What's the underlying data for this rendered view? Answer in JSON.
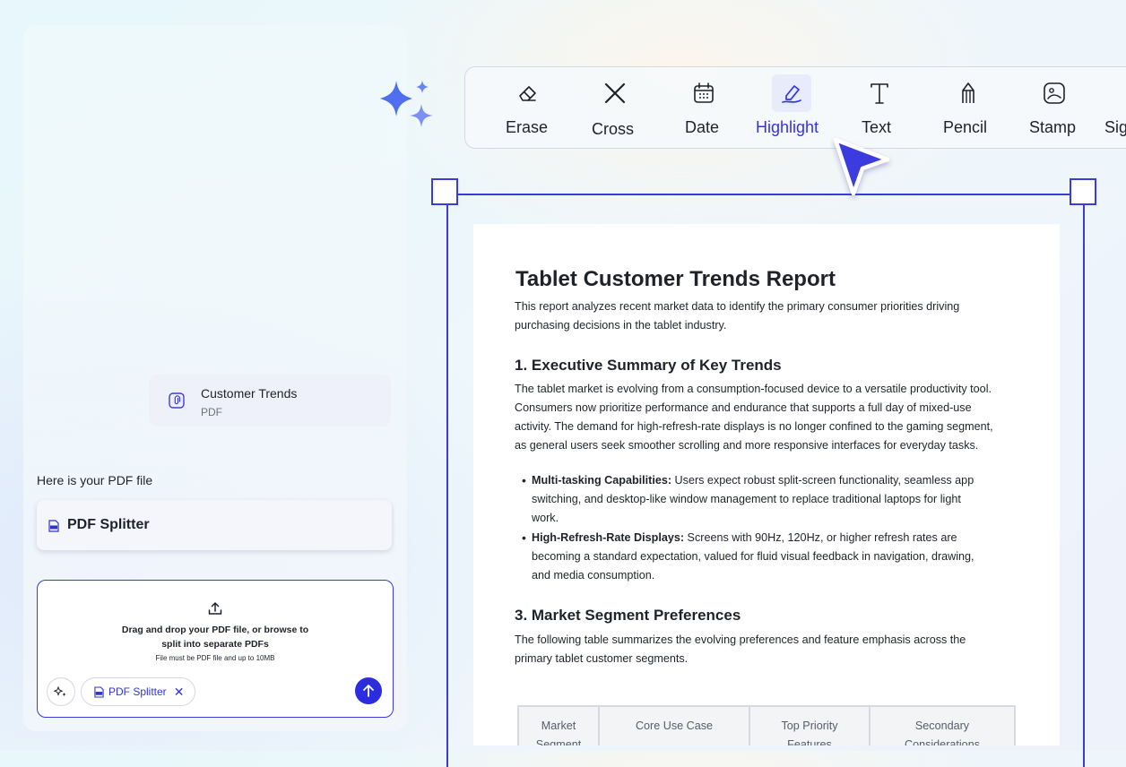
{
  "chat": {
    "file": {
      "name": "Customer Trends",
      "type": "PDF"
    },
    "intro": "Here is your PDF file",
    "tool_card_label": "PDF Splitter",
    "upload": {
      "line1": "Drag and drop your PDF file, or browse to",
      "line2": "split into separate PDFs",
      "hint": "File must be PDF file and up to 10MB",
      "chip_label": "PDF Splitter",
      "chip_close": "✕"
    }
  },
  "toolbar": {
    "active": "Highlight",
    "tools": [
      {
        "label": "Erase",
        "icon": "eraser-icon"
      },
      {
        "label": "Cross",
        "icon": "cross-icon"
      },
      {
        "label": "Date",
        "icon": "calendar-icon"
      },
      {
        "label": "Highlight",
        "icon": "highlighter-icon"
      },
      {
        "label": "Text",
        "icon": "text-icon"
      },
      {
        "label": "Pencil",
        "icon": "pencil-icon"
      },
      {
        "label": "Stamp",
        "icon": "stamp-icon"
      },
      {
        "label": "Sig",
        "icon": "signature-icon"
      }
    ]
  },
  "document": {
    "title": "Tablet Customer Trends Report",
    "intro": [
      "This report analyzes recent market data to identify the primary consumer priorities driving",
      "purchasing decisions in the tablet industry."
    ],
    "section1": {
      "heading": "1. Executive Summary of Key Trends",
      "lines": [
        "The tablet market is evolving from a consumption-focused device to a versatile productivity tool.",
        "Consumers now prioritize performance and endurance that supports a full day of mixed-use",
        "activity. The demand for high-refresh-rate displays is no longer confined to the gaming segment,",
        "as general users seek smoother scrolling and more responsive interfaces for everyday tasks."
      ]
    },
    "bullets": [
      {
        "term": "Multi-tasking Capabilities:",
        "lines": [
          " Users expect robust split-screen functionality, seamless app",
          "switching, and desktop-like window management to replace traditional laptops for light",
          "work."
        ]
      },
      {
        "term": "High-Refresh-Rate Displays:",
        "lines": [
          " Screens with 90Hz, 120Hz, or higher refresh rates are",
          "becoming a standard expectation, valued for fluid visual feedback in navigation, drawing,",
          "and media consumption."
        ]
      }
    ],
    "section3": {
      "heading": "3. Market Segment Preferences",
      "lines": [
        "The following table summarizes the evolving preferences and feature emphasis across the",
        "primary tablet customer segments."
      ]
    },
    "table_headers": [
      [
        "Market",
        "Segment"
      ],
      [
        "Core Use Case"
      ],
      [
        "Top Priority",
        "Features"
      ],
      [
        "Secondary",
        "Considerations"
      ]
    ]
  },
  "colors": {
    "accent": "#3333E6",
    "frame": "#3B3BD8",
    "sparkle": "#5B73F2"
  }
}
